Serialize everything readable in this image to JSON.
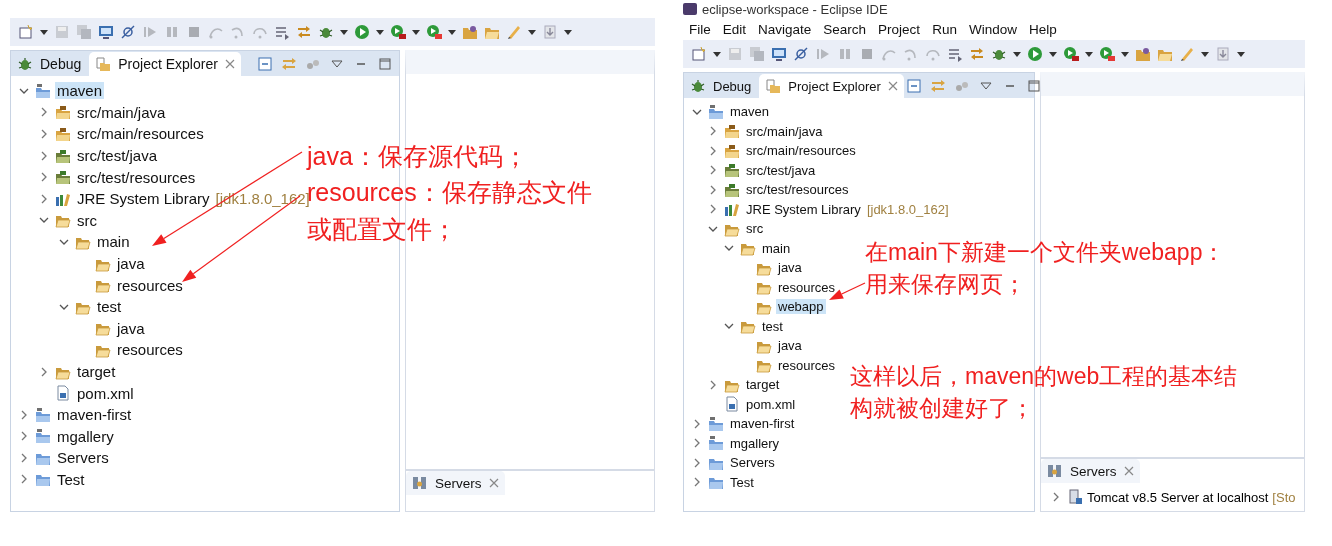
{
  "panels": [
    {
      "tabs": [
        {
          "label": "Debug",
          "kind": "bug",
          "selected": false
        },
        {
          "label": "Project Explorer",
          "kind": "explorer",
          "selected": true
        }
      ],
      "tree": [
        {
          "label": "maven",
          "kind": "maven-project",
          "expanded": true,
          "selected": true,
          "children": [
            {
              "label": "src/main/java",
              "kind": "package",
              "expanded": false,
              "selected": false
            },
            {
              "label": "src/main/resources",
              "kind": "package",
              "expanded": false,
              "selected": false
            },
            {
              "label": "src/test/java",
              "kind": "test-package",
              "expanded": false,
              "selected": false
            },
            {
              "label": "src/test/resources",
              "kind": "test-package",
              "expanded": false,
              "selected": false
            },
            {
              "label": "JRE System Library",
              "decoration": "[jdk1.8.0_162]",
              "kind": "library",
              "expanded": false,
              "selected": false
            },
            {
              "label": "src",
              "kind": "folder",
              "expanded": true,
              "selected": false,
              "children": [
                {
                  "label": "main",
                  "kind": "folder",
                  "expanded": true,
                  "selected": false,
                  "children": [
                    {
                      "label": "java",
                      "kind": "folder",
                      "selected": false
                    },
                    {
                      "label": "resources",
                      "kind": "folder",
                      "selected": false
                    }
                  ]
                },
                {
                  "label": "test",
                  "kind": "folder",
                  "expanded": true,
                  "selected": false,
                  "children": [
                    {
                      "label": "java",
                      "kind": "folder",
                      "selected": false
                    },
                    {
                      "label": "resources",
                      "kind": "folder",
                      "selected": false
                    }
                  ]
                }
              ]
            },
            {
              "label": "target",
              "kind": "folder",
              "expanded": false,
              "selected": false
            },
            {
              "label": "pom.xml",
              "kind": "pom",
              "selected": false
            }
          ]
        },
        {
          "label": "maven-first",
          "kind": "maven-project",
          "expanded": false,
          "selected": false
        },
        {
          "label": "mgallery",
          "kind": "maven-project",
          "expanded": false,
          "selected": false
        },
        {
          "label": "Servers",
          "kind": "project",
          "expanded": false,
          "selected": false
        },
        {
          "label": "Test",
          "kind": "project",
          "expanded": false,
          "selected": false
        }
      ],
      "servers": {
        "tab": "Servers"
      },
      "notes": [
        {
          "lines": [
            "java：保存源代码；",
            "resources：保存静态文件",
            "或配置文件；"
          ]
        }
      ]
    },
    {
      "title": "eclipse-workspace - Eclipse IDE",
      "menu": [
        "File",
        "Edit",
        "Navigate",
        "Search",
        "Project",
        "Run",
        "Window",
        "Help"
      ],
      "tabs": [
        {
          "label": "Debug",
          "kind": "bug",
          "selected": false
        },
        {
          "label": "Project Explorer",
          "kind": "explorer",
          "selected": true
        }
      ],
      "tree": [
        {
          "label": "maven",
          "kind": "maven-project",
          "expanded": true,
          "selected": false,
          "children": [
            {
              "label": "src/main/java",
              "kind": "package",
              "expanded": false,
              "selected": false
            },
            {
              "label": "src/main/resources",
              "kind": "package",
              "expanded": false,
              "selected": false
            },
            {
              "label": "src/test/java",
              "kind": "test-package",
              "expanded": false,
              "selected": false
            },
            {
              "label": "src/test/resources",
              "kind": "test-package",
              "expanded": false,
              "selected": false
            },
            {
              "label": "JRE System Library",
              "decoration": "[jdk1.8.0_162]",
              "kind": "library",
              "expanded": false,
              "selected": false
            },
            {
              "label": "src",
              "kind": "folder",
              "expanded": true,
              "selected": false,
              "children": [
                {
                  "label": "main",
                  "kind": "folder",
                  "expanded": true,
                  "selected": false,
                  "children": [
                    {
                      "label": "java",
                      "kind": "folder",
                      "selected": false
                    },
                    {
                      "label": "resources",
                      "kind": "folder",
                      "selected": false
                    },
                    {
                      "label": "webapp",
                      "kind": "folder",
                      "selected": true
                    }
                  ]
                },
                {
                  "label": "test",
                  "kind": "folder",
                  "expanded": true,
                  "selected": false,
                  "children": [
                    {
                      "label": "java",
                      "kind": "folder",
                      "selected": false
                    },
                    {
                      "label": "resources",
                      "kind": "folder",
                      "selected": false
                    }
                  ]
                }
              ]
            },
            {
              "label": "target",
              "kind": "folder",
              "expanded": false,
              "selected": false
            },
            {
              "label": "pom.xml",
              "kind": "pom",
              "selected": false
            }
          ]
        },
        {
          "label": "maven-first",
          "kind": "maven-project",
          "expanded": false,
          "selected": false
        },
        {
          "label": "mgallery",
          "kind": "maven-project",
          "expanded": false,
          "selected": false
        },
        {
          "label": "Servers",
          "kind": "project",
          "expanded": false,
          "selected": false
        },
        {
          "label": "Test",
          "kind": "project",
          "expanded": false,
          "selected": false
        }
      ],
      "servers": {
        "tab": "Servers",
        "rows": [
          {
            "label": "Tomcat v8.5 Server at localhost",
            "decoration": "[Sto",
            "expanded": false
          }
        ]
      },
      "notes": [
        {
          "lines": [
            "在main下新建一个文件夹webapp：",
            "用来保存网页；"
          ]
        },
        {
          "lines": [
            "这样以后，maven的web工程的基本结",
            "构就被创建好了；"
          ]
        }
      ]
    }
  ]
}
